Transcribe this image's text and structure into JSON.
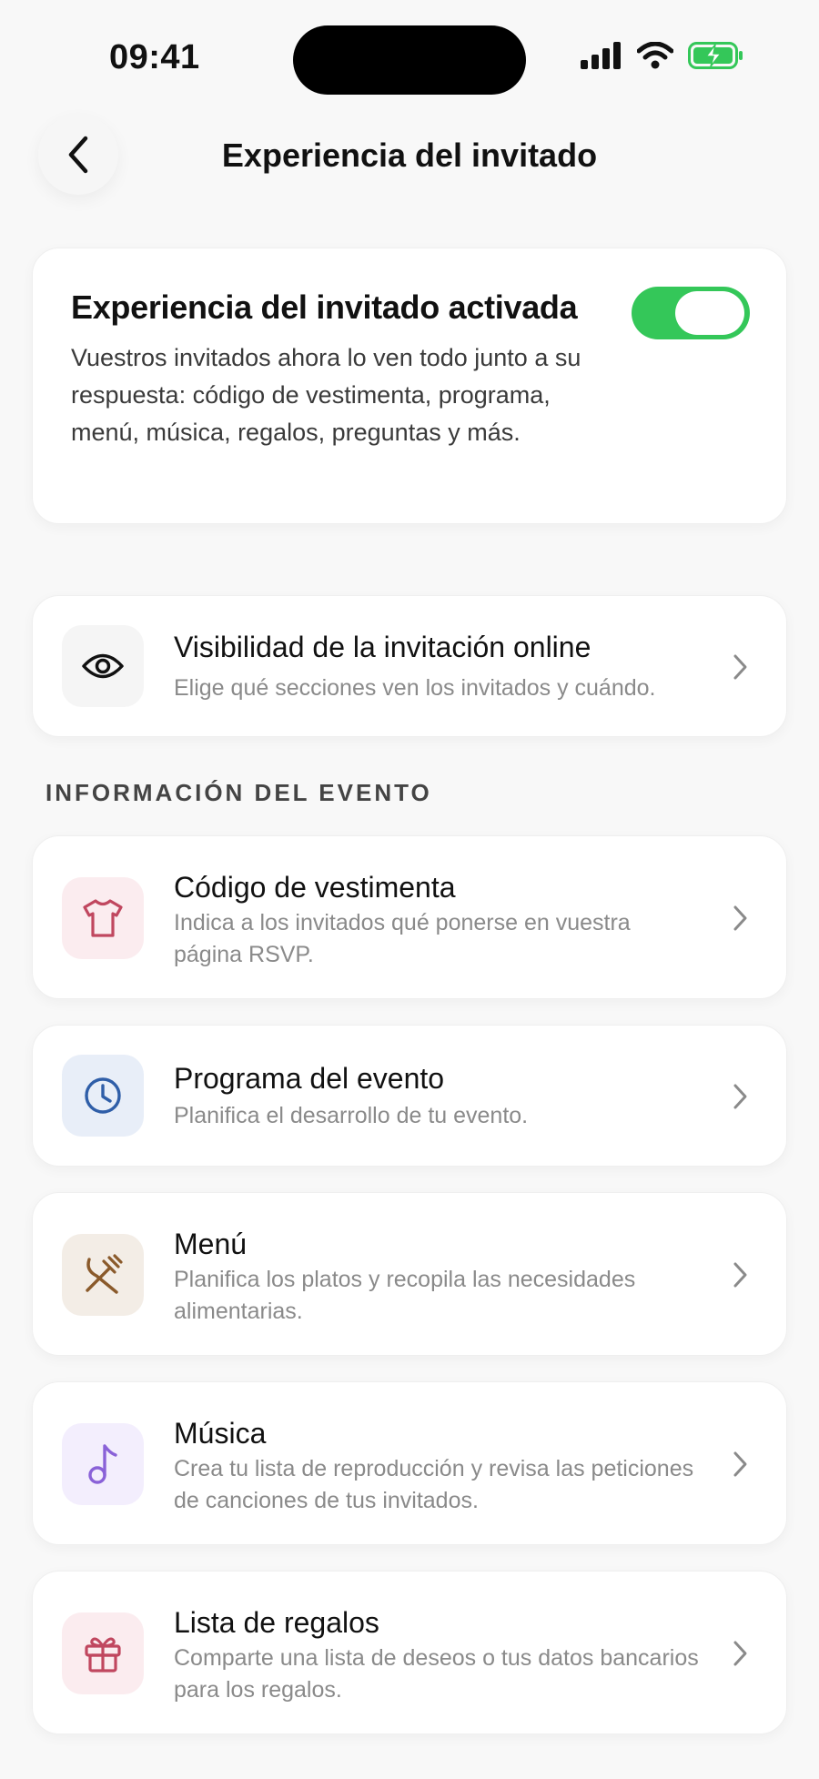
{
  "status_bar": {
    "time": "09:41"
  },
  "header": {
    "title": "Experiencia del invitado"
  },
  "hero": {
    "title": "Experiencia del invitado activada",
    "description": "Vuestros invitados ahora lo ven todo junto a su respuesta: código de vestimenta, programa, menú, música, regalos, preguntas y más.",
    "toggle_on": true,
    "toggle_color": "#34c759"
  },
  "visibility": {
    "title": "Visibilidad de la invitación online",
    "subtitle": "Elige qué secciones ven los invitados y cuándo.",
    "icon": "eye-icon"
  },
  "section_label": "INFORMACIÓN DEL EVENTO",
  "items": [
    {
      "title": "Código de vestimenta",
      "subtitle": "Indica a los invitados qué ponerse en vuestra página RSVP.",
      "icon": "shirt-icon",
      "color": "#c0475f",
      "tile": "#fbecef"
    },
    {
      "title": "Programa del evento",
      "subtitle": "Planifica el desarrollo de tu evento.",
      "icon": "clock-icon",
      "color": "#2f5ea8",
      "tile": "#e8eef8"
    },
    {
      "title": "Menú",
      "subtitle": "Planifica los platos y recopila las necesidades alimentarias.",
      "icon": "utensils-icon",
      "color": "#8a5a2b",
      "tile": "#f3ede6"
    },
    {
      "title": "Música",
      "subtitle": "Crea tu lista de reproducción y revisa las peticiones de canciones de tus invitados.",
      "icon": "music-note-icon",
      "color": "#8a62d8",
      "tile": "#f3eefd"
    },
    {
      "title": "Lista de regalos",
      "subtitle": "Comparte una lista de deseos o tus datos bancarios para los regalos.",
      "icon": "gift-icon",
      "color": "#c0475f",
      "tile": "#fbecef"
    }
  ]
}
